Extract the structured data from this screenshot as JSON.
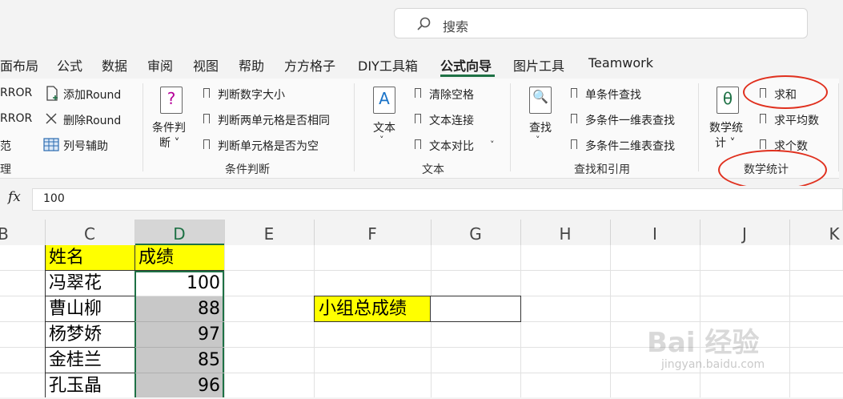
{
  "search": {
    "placeholder": "搜索"
  },
  "tabs": [
    "面布局",
    "公式",
    "数据",
    "审阅",
    "视图",
    "帮助",
    "方方格子",
    "DIY工具箱",
    "公式向导",
    "图片工具",
    "Teamwork"
  ],
  "ribbon": {
    "left_partial": [
      "RROR",
      "RROR",
      "范",
      "理"
    ],
    "round_items": [
      "添加Round",
      "删除Round",
      "列号辅助"
    ],
    "condition": {
      "big_label_1": "条件判",
      "big_label_2": "断 ˅",
      "items": [
        "判断数字大小",
        "判断两单元格是否相同",
        "判断单元格是否为空"
      ],
      "group": "条件判断"
    },
    "text": {
      "big_label": "文本",
      "items": [
        "清除空格",
        "文本连接",
        "文本对比"
      ],
      "group": "文本"
    },
    "lookup": {
      "big_label": "查找",
      "items": [
        "单条件查找",
        "多条件一维表查找",
        "多条件二维表查找"
      ],
      "group": "查找和引用"
    },
    "math": {
      "big_label_1": "数学统",
      "big_label_2": "计 ˅",
      "items": [
        "求和",
        "求平均数",
        "求个数"
      ],
      "group": "数学统计"
    }
  },
  "formula_bar": {
    "fx": "fx",
    "value": "100"
  },
  "columns": [
    "B",
    "C",
    "D",
    "E",
    "F",
    "G",
    "H",
    "I",
    "J",
    "K"
  ],
  "table": {
    "headers": [
      "姓名",
      "成绩"
    ],
    "rows": [
      {
        "name": "冯翠花",
        "score": "100"
      },
      {
        "name": "曹山柳",
        "score": "88"
      },
      {
        "name": "杨梦娇",
        "score": "97"
      },
      {
        "name": "金桂兰",
        "score": "85"
      },
      {
        "name": "孔玉晶",
        "score": "96"
      }
    ]
  },
  "summary_label": "小组总成绩",
  "colors": {
    "highlight_yellow": "#ffff00",
    "selection_gray": "#c8c8c8",
    "accent_green": "#1e7145",
    "annotation_red": "#e0301e"
  },
  "watermark": {
    "text": "Bai 经验",
    "url": "jingyan.baidu.com"
  }
}
